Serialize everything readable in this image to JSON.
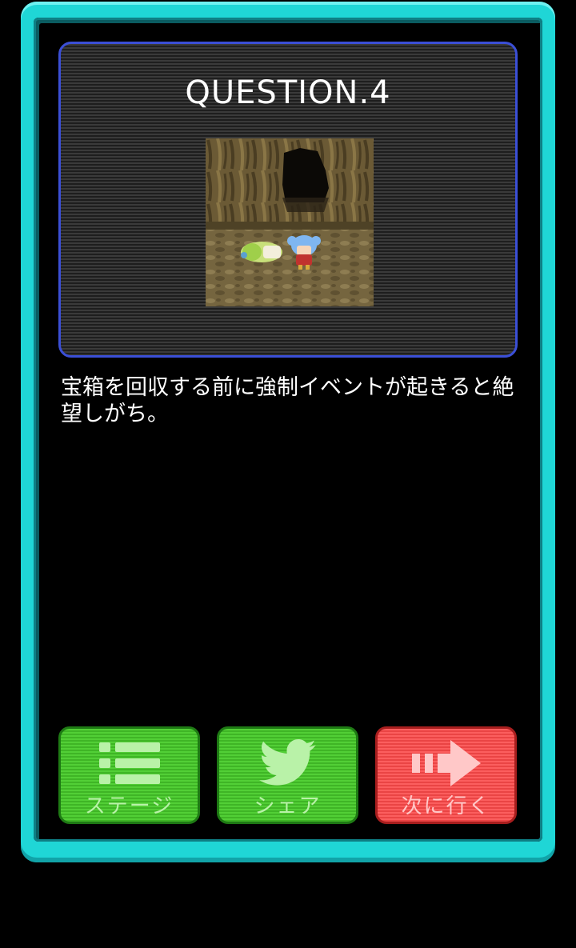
{
  "question": {
    "title": "QUESTION.4",
    "description": "宝箱を回収する前に強制イベントが起きると絶望しがち。"
  },
  "buttons": {
    "stage": {
      "label": "ステージ",
      "icon": "list-icon"
    },
    "share": {
      "label": "シェア",
      "icon": "twitter-bird-icon"
    },
    "next": {
      "label": "次に行く",
      "icon": "arrow-right-icon"
    }
  },
  "colors": {
    "frame": "#1fd6d6",
    "panel_border": "#3b4fd6",
    "button_green": "#46c22c",
    "button_red": "#f25050"
  }
}
